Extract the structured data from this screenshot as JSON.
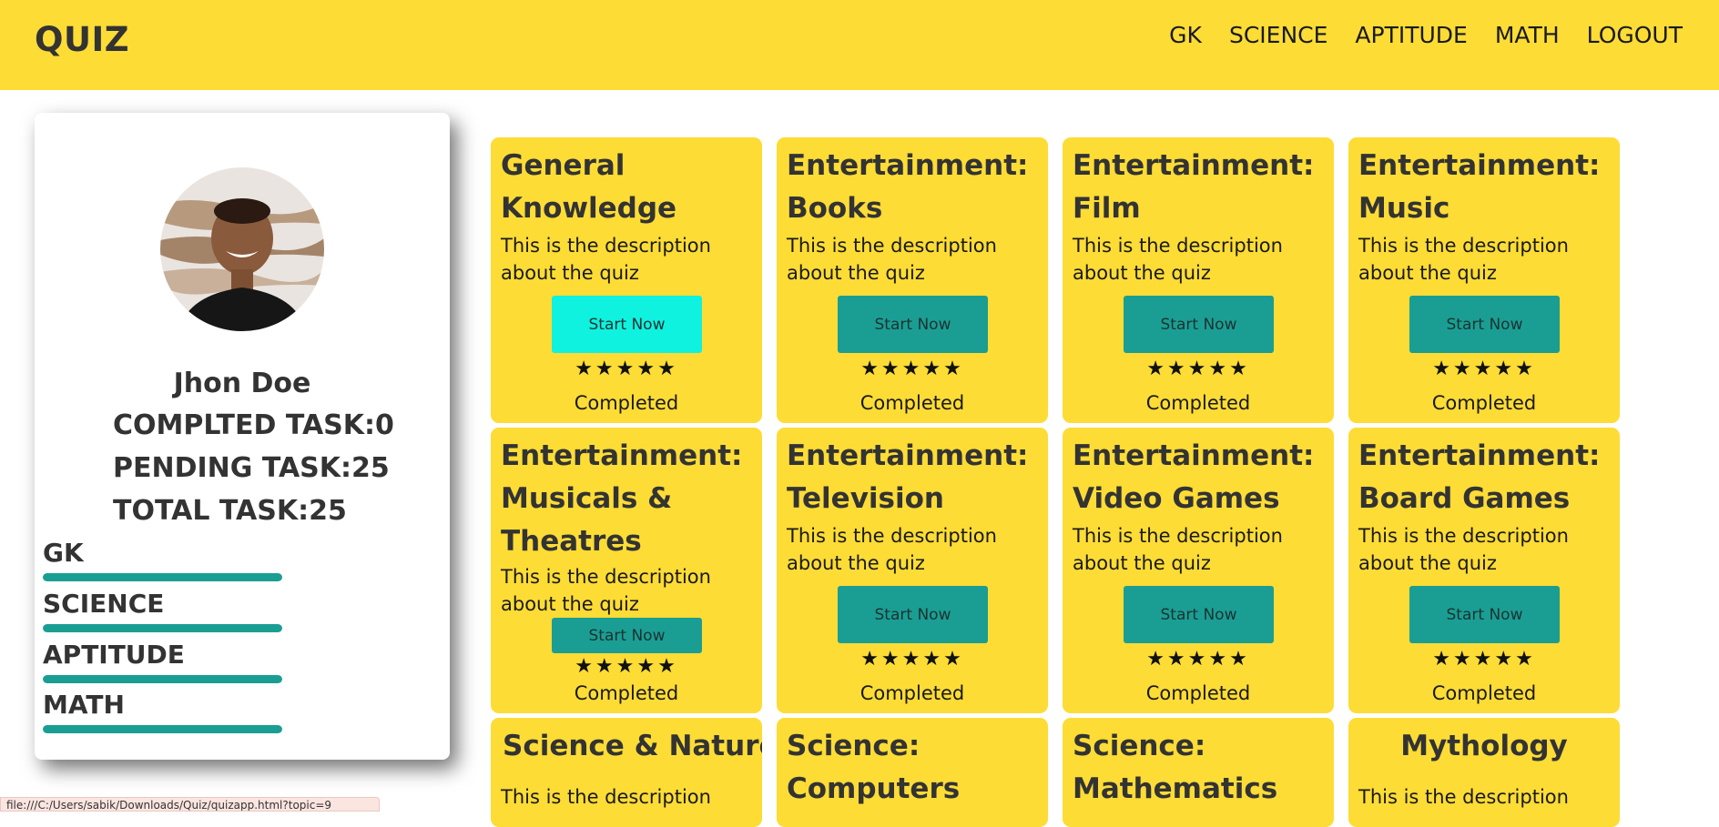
{
  "app": {
    "brand": "QUIZ"
  },
  "nav": {
    "links": [
      "GK",
      "SCIENCE",
      "APTITUDE",
      "MATH",
      "LOGOUT"
    ]
  },
  "profile": {
    "name": "Jhon Doe",
    "completed_task": "COMPLTED TASK:0",
    "pending_task": "PENDING TASK:25",
    "total_task": "TOTAL TASK:25",
    "progress": [
      {
        "label": "GK",
        "value": 1.0
      },
      {
        "label": "SCIENCE",
        "value": 1.0
      },
      {
        "label": "APTITUDE",
        "value": 1.0
      },
      {
        "label": "MATH",
        "value": 1.0
      }
    ]
  },
  "quizzes": [
    {
      "title": "General Knowledge",
      "description": "This is the description about the quiz",
      "button": "Start Now",
      "stars": "★★★★★",
      "status": "Completed"
    },
    {
      "title": "Entertainment: Books",
      "description": "This is the description about the quiz",
      "button": "Start Now",
      "stars": "★★★★★",
      "status": "Completed"
    },
    {
      "title": "Entertainment: Film",
      "description": "This is the description about the quiz",
      "button": "Start Now",
      "stars": "★★★★★",
      "status": "Completed"
    },
    {
      "title": "Entertainment: Music",
      "description": "This is the description about the quiz",
      "button": "Start Now",
      "stars": "★★★★★",
      "status": "Completed"
    },
    {
      "title": "Entertainment: Musicals & Theatres",
      "description": "This is the description about the quiz",
      "button": "Start Now",
      "stars": "★★★★★",
      "status": "Completed"
    },
    {
      "title": "Entertainment: Television",
      "description": "This is the description about the quiz",
      "button": "Start Now",
      "stars": "★★★★★",
      "status": "Completed"
    },
    {
      "title": "Entertainment: Video Games",
      "description": "This is the description about the quiz",
      "button": "Start Now",
      "stars": "★★★★★",
      "status": "Completed"
    },
    {
      "title": "Entertainment: Board Games",
      "description": "This is the description about the quiz",
      "button": "Start Now",
      "stars": "★★★★★",
      "status": "Completed"
    },
    {
      "title": "Science & Nature",
      "description": "This is the description"
    },
    {
      "title": "Science: Computers"
    },
    {
      "title": "Science: Mathematics"
    },
    {
      "title": "Mythology",
      "description": "This is the description"
    }
  ],
  "status_bar": {
    "url": "file:///C:/Users/sabik/Downloads/Quiz/quizapp.html?topic=9"
  },
  "colors": {
    "navbar": "#fddc35",
    "card": "#fddc35",
    "button": "#1a9e94",
    "button_active": "#0ff2e0",
    "progress": "#1a9e94"
  }
}
